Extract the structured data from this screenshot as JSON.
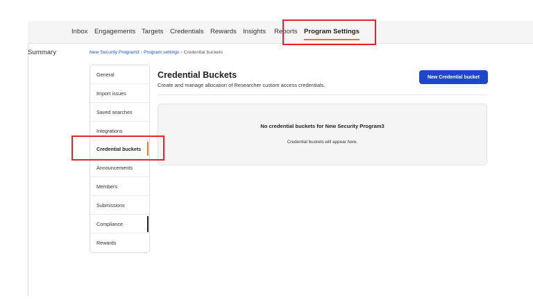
{
  "nav": {
    "tabs": [
      {
        "label": "Summary"
      },
      {
        "label": "Inbox"
      },
      {
        "label": "Engagements"
      },
      {
        "label": "Targets"
      },
      {
        "label": "Credentials"
      },
      {
        "label": "Rewards"
      },
      {
        "label": "Insights"
      },
      {
        "label": "Reports"
      },
      {
        "label": "Program Settings",
        "active": true
      }
    ]
  },
  "breadcrumb": {
    "program": "New Security Program3",
    "settings": "Program settings",
    "current": "Credential buckets",
    "separator": "›"
  },
  "sidebar": {
    "items": [
      {
        "label": "General"
      },
      {
        "label": "Import issues"
      },
      {
        "label": "Saved searches"
      },
      {
        "label": "Integrations"
      },
      {
        "label": "Credential buckets",
        "active": true
      },
      {
        "label": "Announcements"
      },
      {
        "label": "Members"
      },
      {
        "label": "Submissions"
      },
      {
        "label": "Compliance"
      },
      {
        "label": "Rewards"
      }
    ]
  },
  "main": {
    "title": "Credential Buckets",
    "subtitle": "Create and manage allocation of Researcher custom access credentials.",
    "new_button": "New Credential bucket",
    "empty_title": "No credential buckets for New Security Program3",
    "empty_desc": "Credential buckets will appear here."
  },
  "colors": {
    "accent": "#e8781a",
    "primary": "#1f46c9",
    "highlight": "#e0262b"
  }
}
